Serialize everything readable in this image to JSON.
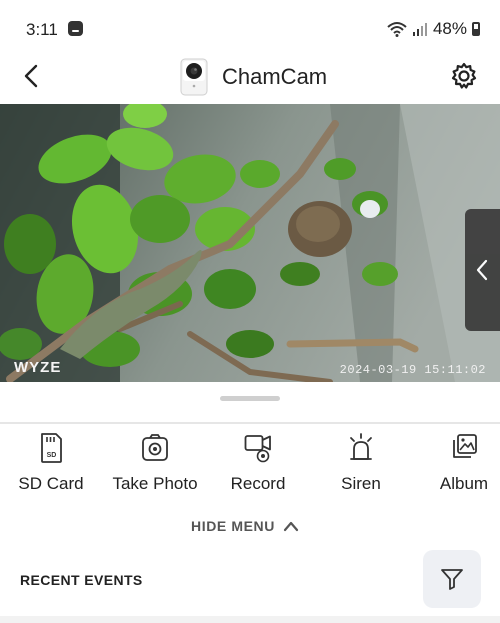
{
  "status_bar": {
    "time": "3:11",
    "battery": "48%"
  },
  "header": {
    "title": "ChamCam",
    "back_icon": "chevron-left-icon",
    "settings_icon": "gear-icon"
  },
  "feed": {
    "watermark": "WYZE",
    "timestamp": "2024-03-19 15:11:02"
  },
  "menu": {
    "items": [
      {
        "label": "SD Card",
        "icon": "sd-card-icon"
      },
      {
        "label": "Take Photo",
        "icon": "camera-icon"
      },
      {
        "label": "Record",
        "icon": "record-icon"
      },
      {
        "label": "Siren",
        "icon": "siren-icon"
      },
      {
        "label": "Album",
        "icon": "album-icon"
      }
    ],
    "hide_label": "HIDE MENU"
  },
  "events": {
    "title": "RECENT EVENTS",
    "filter_icon": "filter-icon"
  }
}
